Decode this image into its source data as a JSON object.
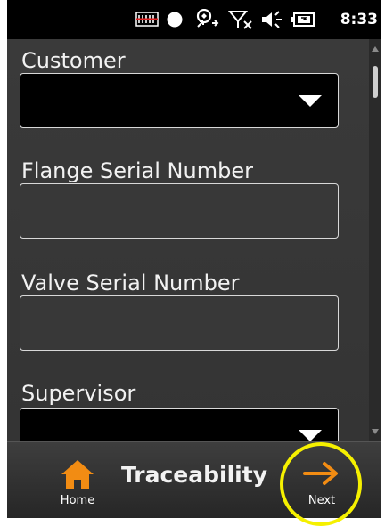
{
  "status_bar": {
    "time": "8:33",
    "icons": [
      "signal-strength-icon",
      "circle-icon",
      "connectivity-icon",
      "no-signal-icon",
      "volume-icon",
      "battery-icon"
    ]
  },
  "form": {
    "customer": {
      "label": "Customer",
      "value": ""
    },
    "flange_serial": {
      "label": "Flange Serial Number",
      "value": ""
    },
    "valve_serial": {
      "label": "Valve Serial Number",
      "value": ""
    },
    "supervisor": {
      "label": "Supervisor",
      "value": ""
    }
  },
  "bottom_bar": {
    "title": "Traceability",
    "home_label": "Home",
    "next_label": "Next"
  },
  "colors": {
    "highlight": "#f5f000",
    "accent_orange": "#f28c13"
  }
}
